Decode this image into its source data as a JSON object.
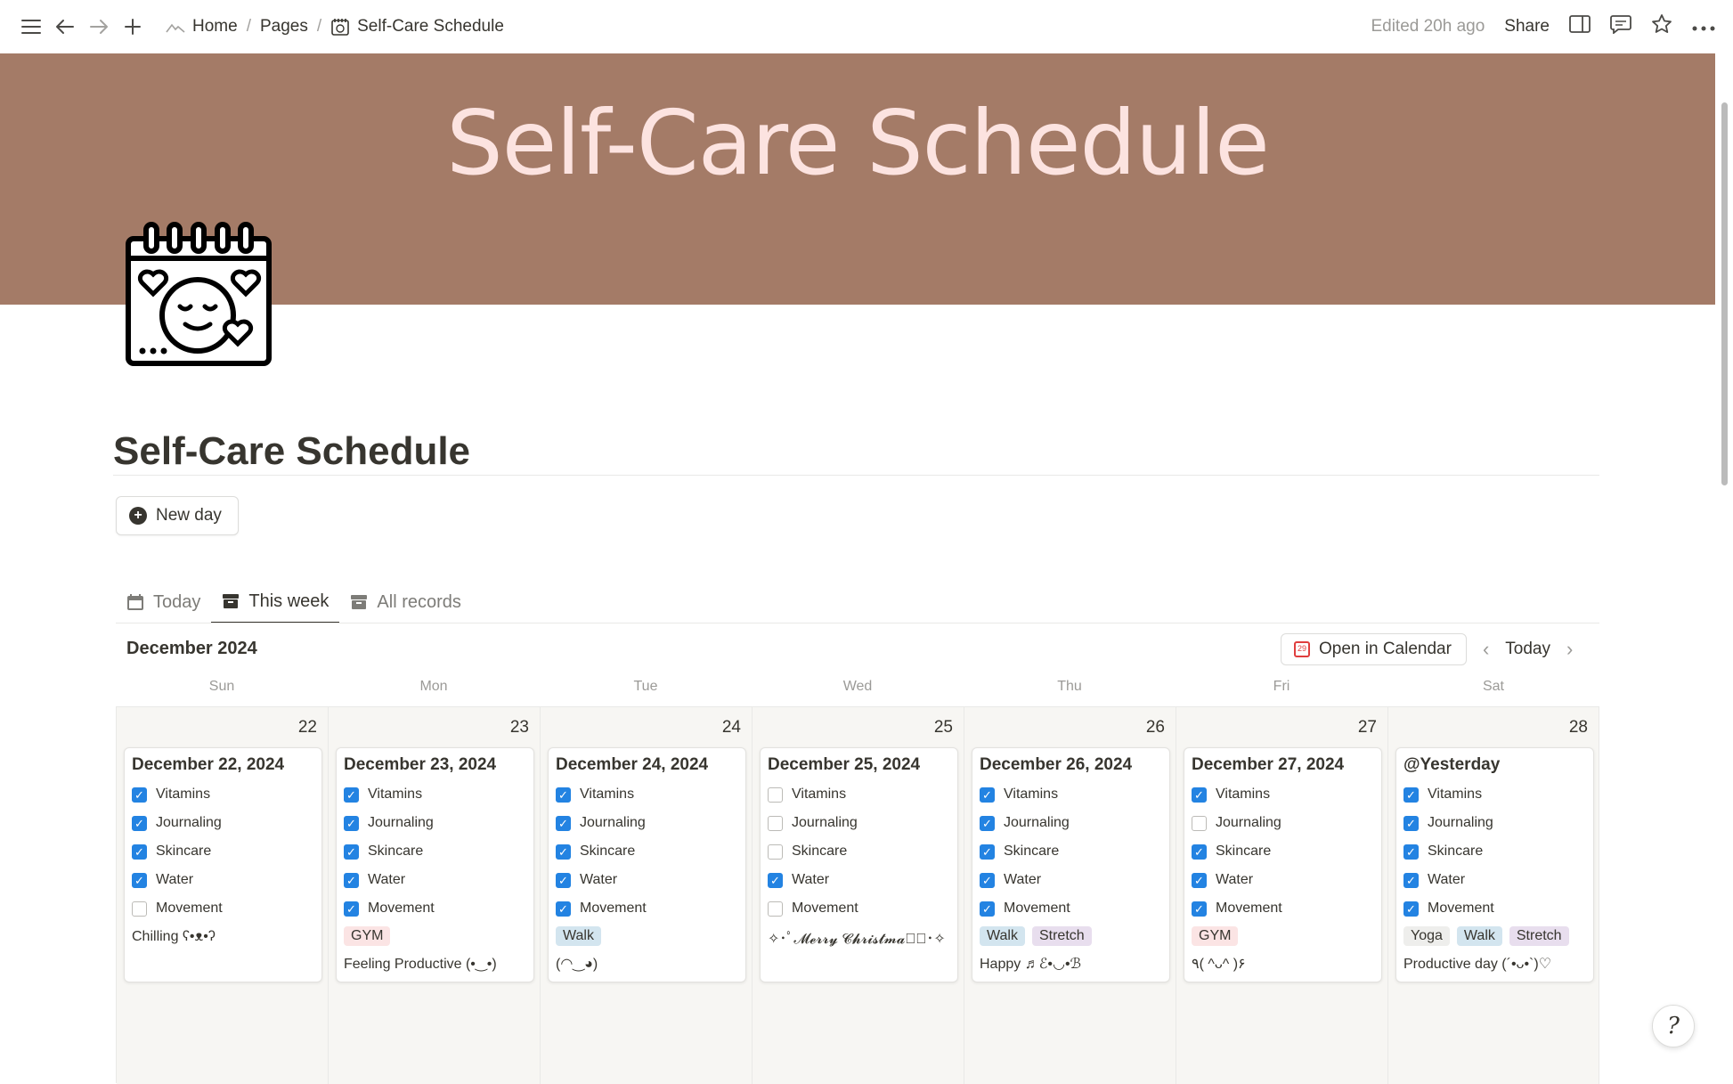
{
  "topbar": {
    "breadcrumbs": [
      "Home",
      "Pages",
      "Self-Care Schedule"
    ],
    "edited": "Edited 20h ago",
    "share": "Share"
  },
  "cover": {
    "title": "Self-Care Schedule",
    "color": "#a47b67"
  },
  "page": {
    "title": "Self-Care Schedule",
    "new_day_label": "New day"
  },
  "tabs": [
    {
      "label": "Today",
      "icon": "calendar-icon",
      "active": false
    },
    {
      "label": "This week",
      "icon": "archive-icon",
      "active": true
    },
    {
      "label": "All records",
      "icon": "archive-icon",
      "active": false
    }
  ],
  "calendar": {
    "month": "December 2024",
    "open_label": "Open in Calendar",
    "today_label": "Today",
    "weekdays": [
      "Sun",
      "Mon",
      "Tue",
      "Wed",
      "Thu",
      "Fri",
      "Sat"
    ],
    "days": [
      {
        "num": "22",
        "title": "December 22, 2024",
        "checks": [
          [
            "Vitamins",
            true
          ],
          [
            "Journaling",
            true
          ],
          [
            "Skincare",
            true
          ],
          [
            "Water",
            true
          ],
          [
            "Movement",
            false
          ]
        ],
        "tags": [],
        "note": "Chilling ʕ•ᴥ•ʔ"
      },
      {
        "num": "23",
        "title": "December 23, 2024",
        "checks": [
          [
            "Vitamins",
            true
          ],
          [
            "Journaling",
            true
          ],
          [
            "Skincare",
            true
          ],
          [
            "Water",
            true
          ],
          [
            "Movement",
            true
          ]
        ],
        "tags": [
          "GYM"
        ],
        "note": "Feeling Productive (•‿•)"
      },
      {
        "num": "24",
        "title": "December 24, 2024",
        "checks": [
          [
            "Vitamins",
            true
          ],
          [
            "Journaling",
            true
          ],
          [
            "Skincare",
            true
          ],
          [
            "Water",
            true
          ],
          [
            "Movement",
            true
          ]
        ],
        "tags": [
          "Walk"
        ],
        "note": "(◠‿◕)"
      },
      {
        "num": "25",
        "title": "December 25, 2024",
        "checks": [
          [
            "Vitamins",
            false
          ],
          [
            "Journaling",
            false
          ],
          [
            "Skincare",
            false
          ],
          [
            "Water",
            true
          ],
          [
            "Movement",
            false
          ]
        ],
        "tags": [],
        "note": "✧･ﾟ𝓜𝓮𝓻𝓻𝔂 𝓒𝓱𝓻𝓲𝓼𝓽𝓶𝓪𝓼ﾟ･✧"
      },
      {
        "num": "26",
        "title": "December 26, 2024",
        "checks": [
          [
            "Vitamins",
            true
          ],
          [
            "Journaling",
            true
          ],
          [
            "Skincare",
            true
          ],
          [
            "Water",
            true
          ],
          [
            "Movement",
            true
          ]
        ],
        "tags": [
          "Walk",
          "Stretch"
        ],
        "note": "Happy ♬ℰ•◡•ℬ"
      },
      {
        "num": "27",
        "title": "December 27, 2024",
        "checks": [
          [
            "Vitamins",
            true
          ],
          [
            "Journaling",
            false
          ],
          [
            "Skincare",
            true
          ],
          [
            "Water",
            true
          ],
          [
            "Movement",
            true
          ]
        ],
        "tags": [
          "GYM"
        ],
        "note": "٩( ^ᴗ^ )۶"
      },
      {
        "num": "28",
        "title": "@Yesterday",
        "checks": [
          [
            "Vitamins",
            true
          ],
          [
            "Journaling",
            true
          ],
          [
            "Skincare",
            true
          ],
          [
            "Water",
            true
          ],
          [
            "Movement",
            true
          ]
        ],
        "tags": [
          "Yoga",
          "Walk",
          "Stretch"
        ],
        "note": "Productive day (´•ᴗ•`)♡"
      }
    ]
  },
  "tag_colors": {
    "GYM": "#fbe4e4",
    "Walk": "#d3e5ef",
    "Stretch": "#e8deee",
    "Yoga": "#eeeeec"
  }
}
